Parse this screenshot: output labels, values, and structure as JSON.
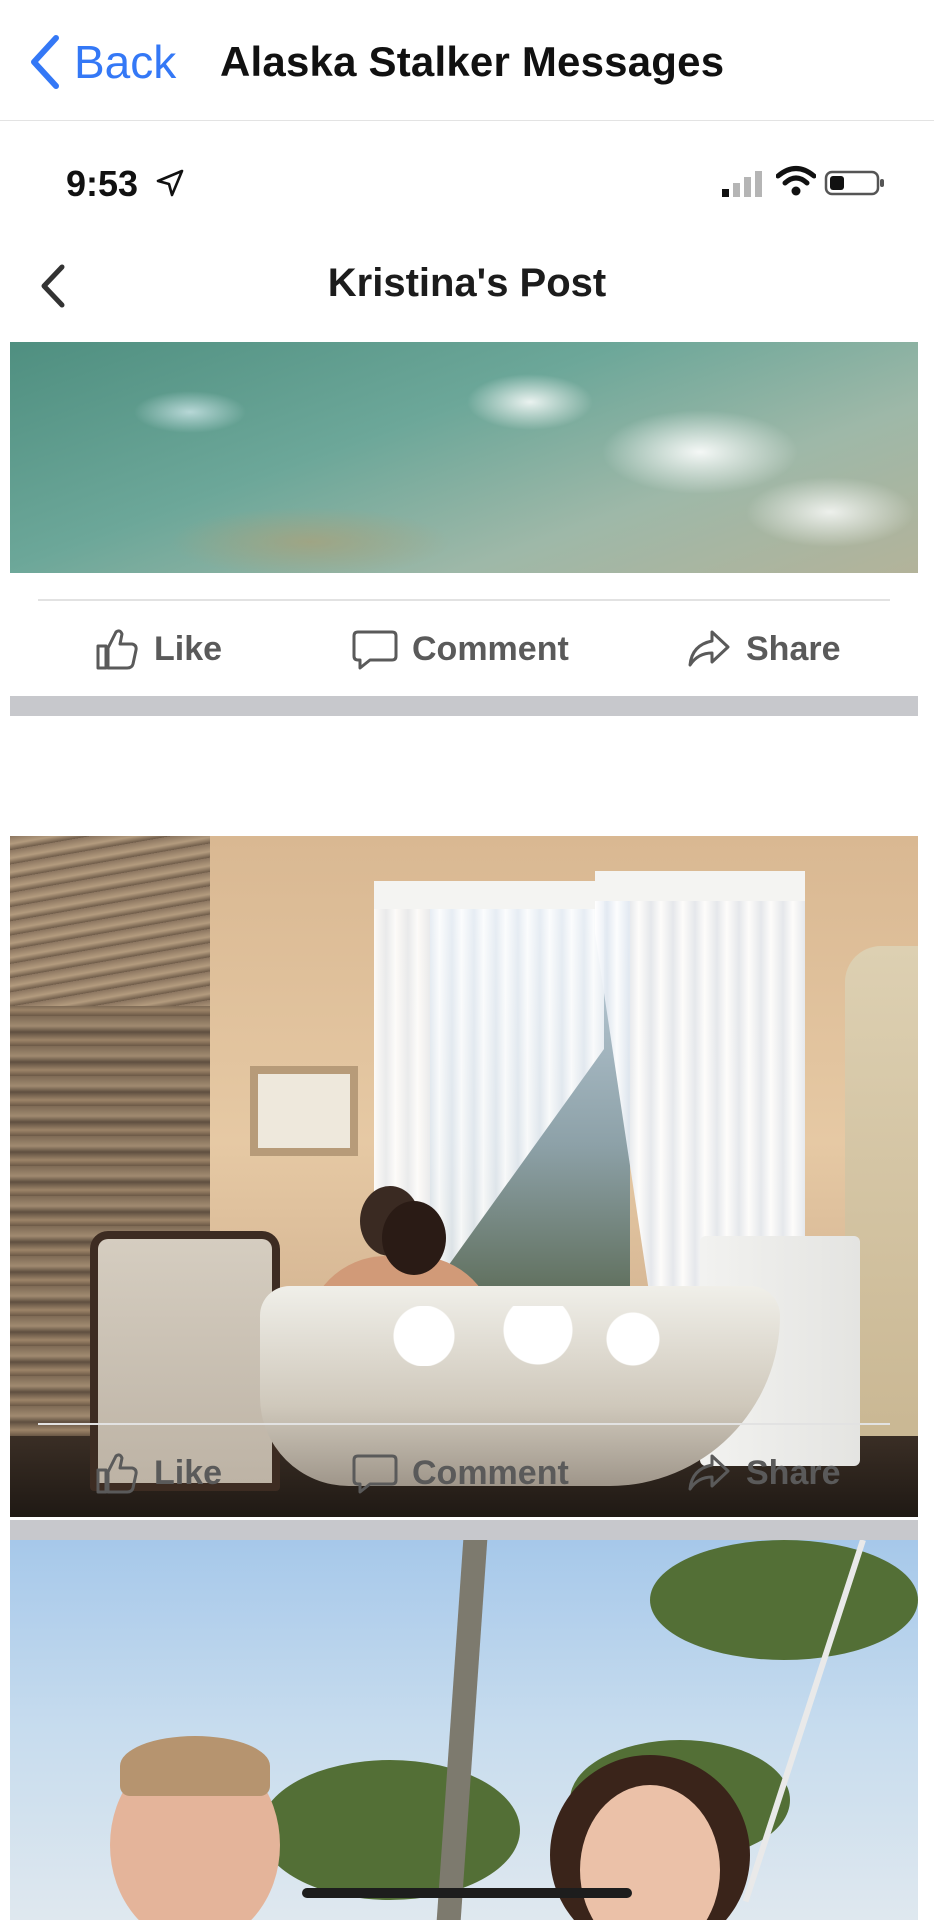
{
  "app_nav": {
    "back_label": "Back",
    "title": "Alaska Stalker Messages",
    "accent_color": "#3478f6"
  },
  "status_bar": {
    "time": "9:53",
    "icons": [
      "location-arrow-icon",
      "cellular-signal-icon",
      "wifi-icon",
      "battery-icon"
    ]
  },
  "post": {
    "title": "Kristina's Post",
    "back_icon": "chevron-left-icon"
  },
  "actions": [
    {
      "like": "Like",
      "comment": "Comment",
      "share": "Share"
    },
    {
      "like": "Like",
      "comment": "Comment",
      "share": "Share"
    }
  ],
  "photos": [
    {
      "subject": "water"
    },
    {
      "subject": "bathtub"
    },
    {
      "subject": "couple-outdoors"
    }
  ]
}
